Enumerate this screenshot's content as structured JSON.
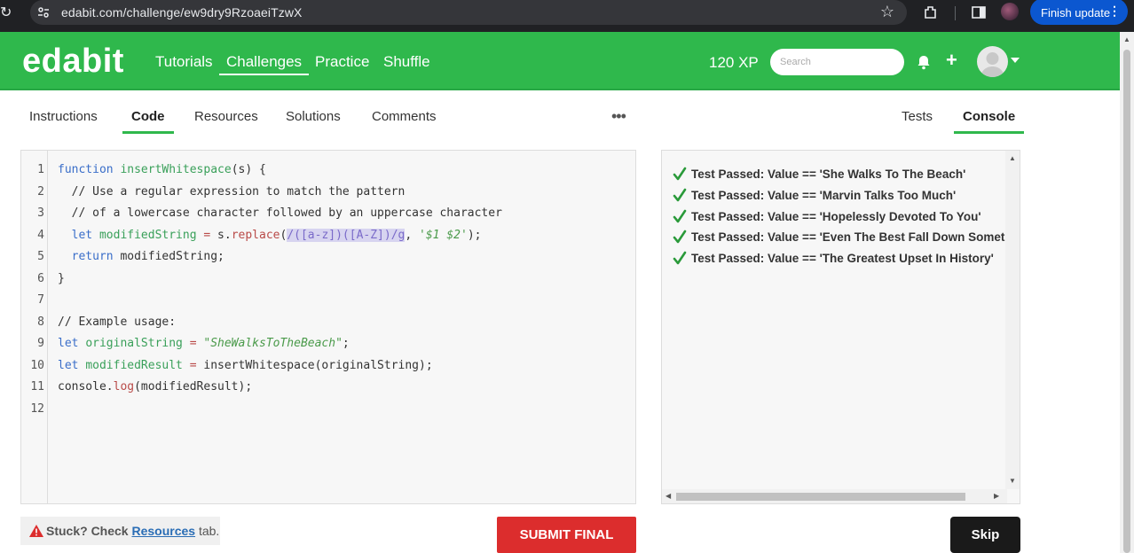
{
  "browser": {
    "url": "edabit.com/challenge/ew9dry9RzoaeiTzwX",
    "finish_update": "Finish update"
  },
  "nav": {
    "logo": "edabit",
    "links": [
      "Tutorials",
      "Challenges",
      "Practice",
      "Shuffle"
    ],
    "active_link": "Challenges",
    "xp": "120 XP",
    "search_placeholder": "Search"
  },
  "tabs": {
    "left": [
      "Instructions",
      "Code",
      "Resources",
      "Solutions",
      "Comments"
    ],
    "left_active": "Code",
    "more": "•••",
    "right": [
      "Tests",
      "Console"
    ],
    "right_active": "Console"
  },
  "editor": {
    "line_numbers": [
      "1",
      "2",
      "3",
      "4",
      "5",
      "6",
      "7",
      "8",
      "9",
      "10",
      "11",
      "12"
    ],
    "lines": [
      "function insertWhitespace(s) {",
      "  // Use a regular expression to match the pattern",
      "  // of a lowercase character followed by an uppercase character",
      "  let modifiedString = s.replace(/([a-z])([A-Z])/g, '$1 $2');",
      "  return modifiedString;",
      "}",
      "",
      "// Example usage:",
      "let originalString = \"SheWalksToTheBeach\";",
      "let modifiedResult = insertWhitespace(originalString);",
      "console.log(modifiedResult);",
      ""
    ]
  },
  "console": {
    "results": [
      "Test Passed: Value == 'She Walks To The Beach'",
      "Test Passed: Value == 'Marvin Talks Too Much'",
      "Test Passed: Value == 'Hopelessly Devoted To You'",
      "Test Passed: Value == 'Even The Best Fall Down Sometimes'",
      "Test Passed: Value == 'The Greatest Upset In History'"
    ]
  },
  "footer": {
    "stuck_prefix": "Stuck? Check",
    "stuck_link": "Resources",
    "stuck_suffix": "tab.",
    "submit": "SUBMIT FINAL",
    "skip": "Skip"
  },
  "colors": {
    "brand_green": "#2fb84c",
    "submit_red": "#dc2d2d",
    "skip_black": "#1a1a1a",
    "pass_green": "#2a9a3a"
  },
  "icons": [
    "reload-icon",
    "site-info-icon",
    "star-icon",
    "extensions-icon",
    "side-panel-icon",
    "bell-icon",
    "plus-icon",
    "user-avatar",
    "check-icon",
    "warning-icon"
  ]
}
